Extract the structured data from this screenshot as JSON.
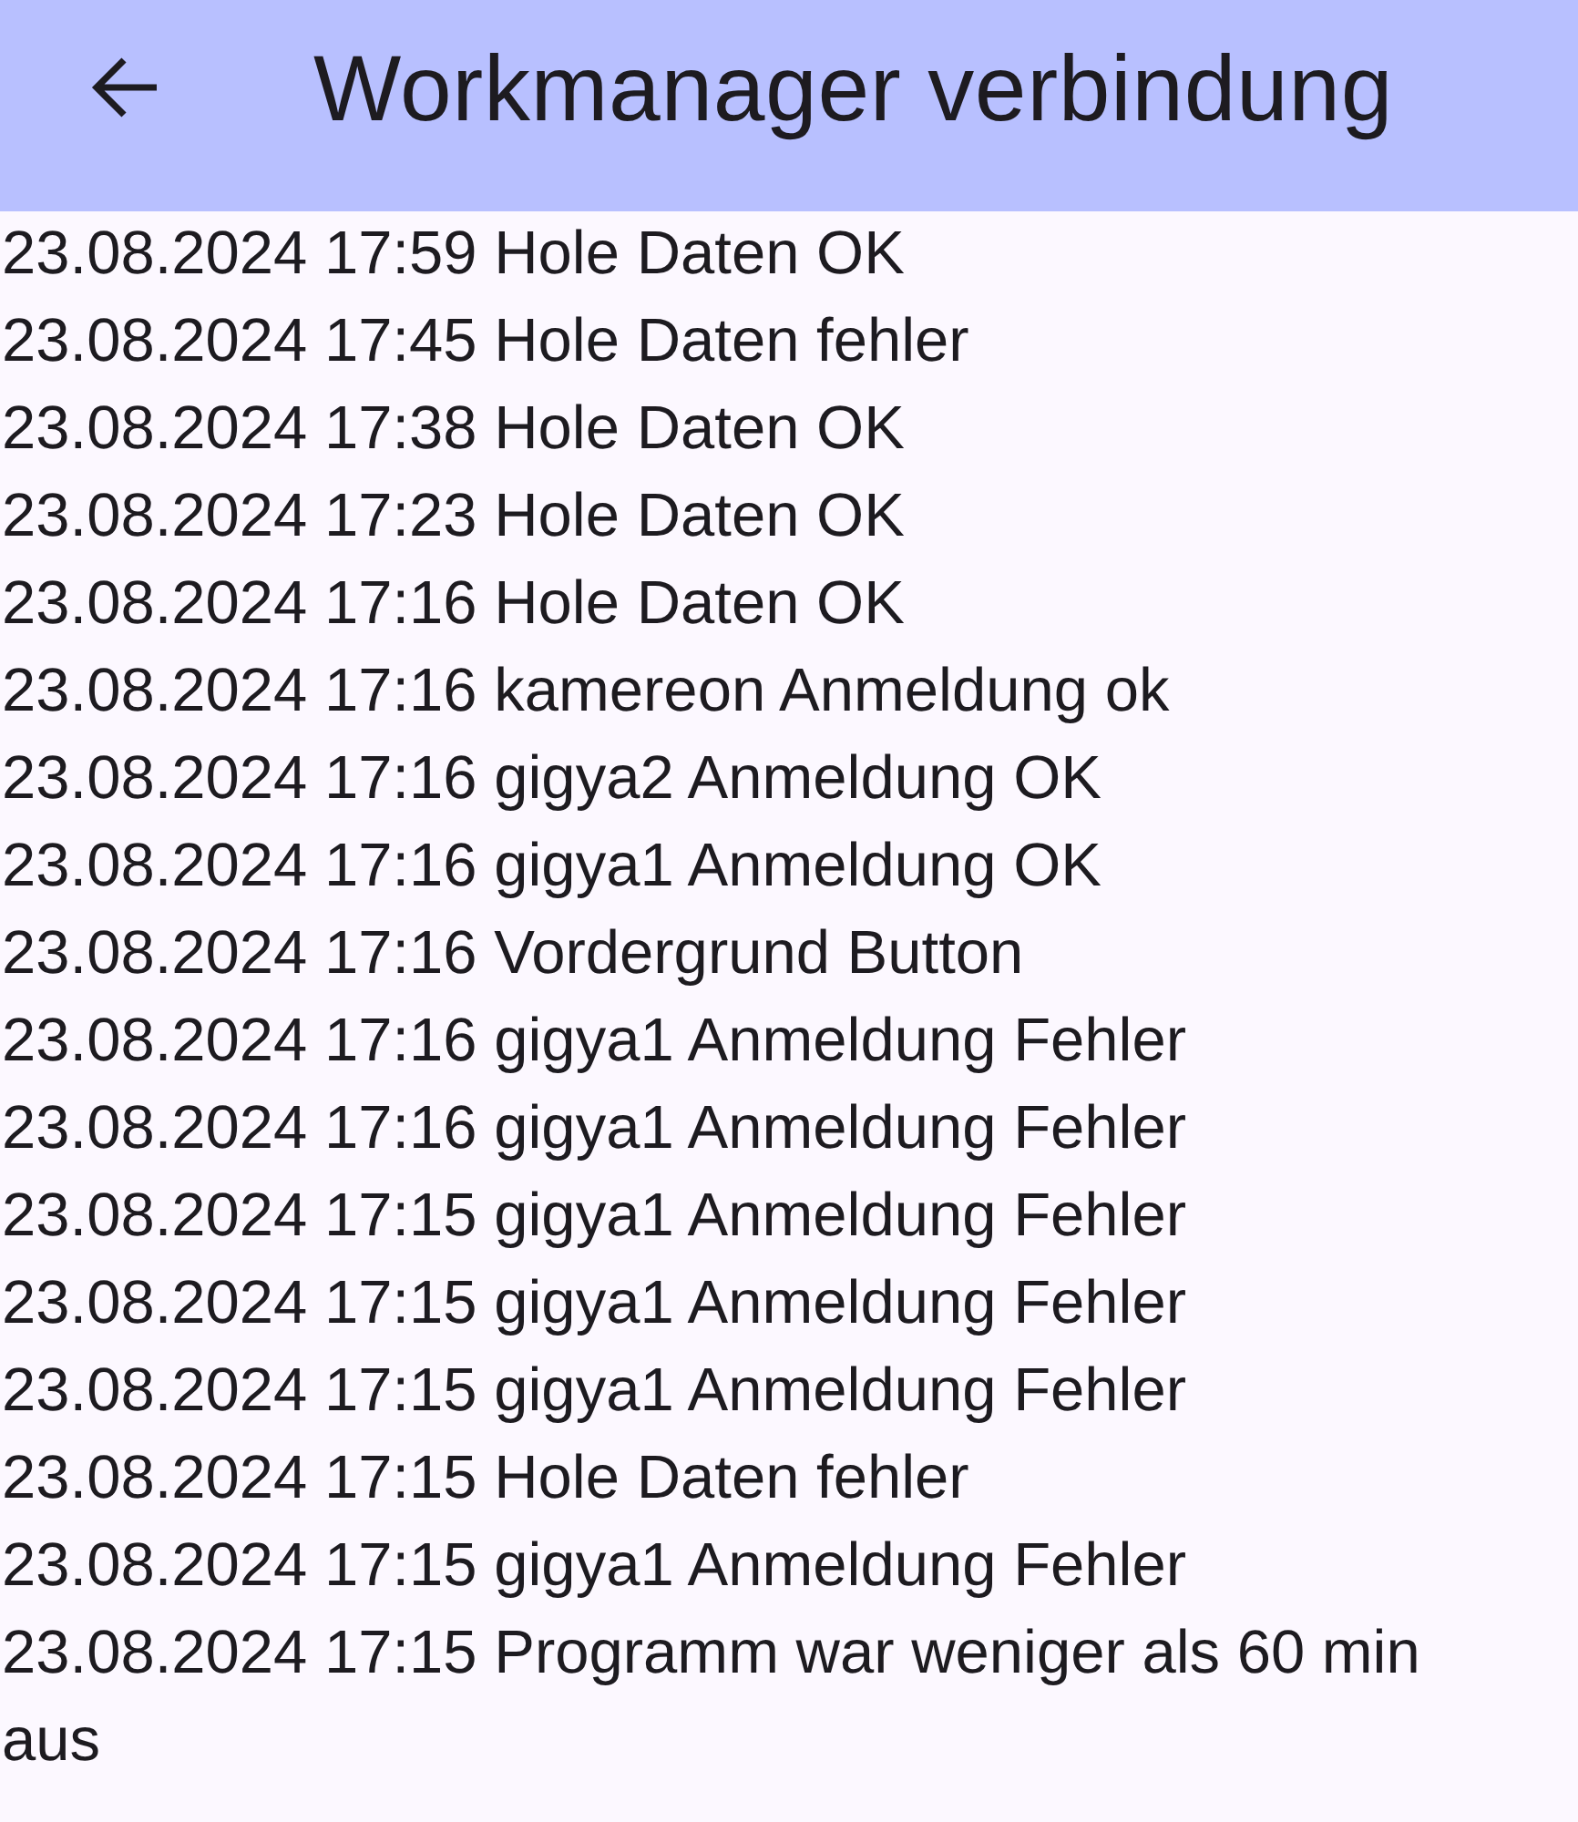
{
  "app_bar": {
    "title": "Workmanager verbindung"
  },
  "log_entries": [
    "23.08.2024 17:59 Hole Daten OK",
    "23.08.2024 17:45 Hole Daten fehler",
    "23.08.2024 17:38 Hole Daten OK",
    "23.08.2024 17:23 Hole Daten OK",
    "23.08.2024 17:16 Hole Daten OK",
    "23.08.2024 17:16 kamereon Anmeldung ok",
    "23.08.2024 17:16 gigya2 Anmeldung OK",
    "23.08.2024 17:16 gigya1 Anmeldung OK",
    "23.08.2024 17:16 Vordergrund Button",
    "23.08.2024 17:16 gigya1 Anmeldung Fehler",
    "23.08.2024 17:16 gigya1 Anmeldung Fehler",
    "23.08.2024 17:15 gigya1 Anmeldung Fehler",
    "23.08.2024 17:15 gigya1 Anmeldung Fehler",
    "23.08.2024 17:15 gigya1 Anmeldung Fehler",
    "23.08.2024 17:15 Hole Daten fehler",
    "23.08.2024 17:15 gigya1 Anmeldung Fehler",
    "23.08.2024 17:15 Programm war weniger als 60 min aus"
  ]
}
